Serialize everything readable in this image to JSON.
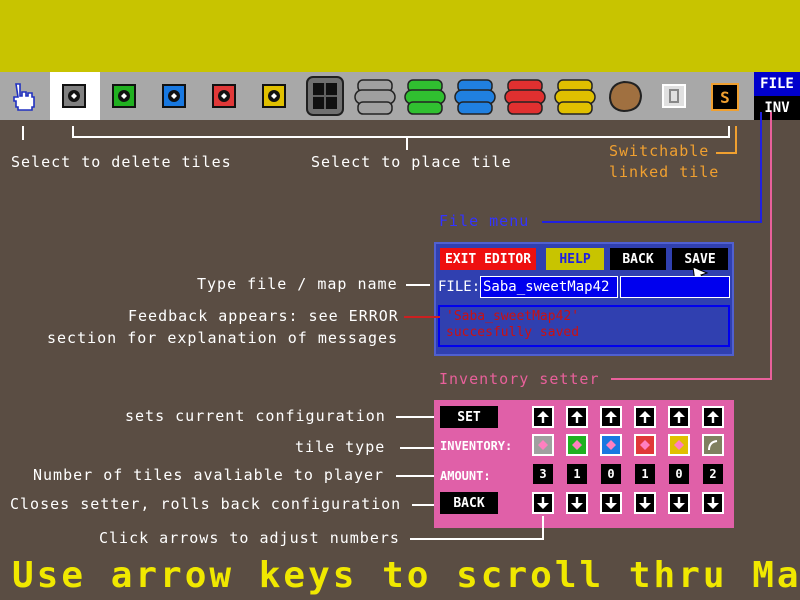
{
  "toolbar": {
    "file_label": "FILE",
    "inv_label": "INV",
    "tile_colors": [
      "#808080",
      "#20b020",
      "#1878e0",
      "#e03838",
      "#e0c000"
    ],
    "tank_colors": [
      "#a0a0a0",
      "#30c030",
      "#2080e0",
      "#e03030",
      "#e0c000"
    ],
    "switch_tile_label": "S"
  },
  "callouts": {
    "delete": "Select to delete tiles",
    "place": "Select to place tile",
    "switchable": "Switchable",
    "linked": "linked tile",
    "file_menu": "File menu",
    "type_name": "Type file / map name",
    "feedback_1": "Feedback appears: see ERROR",
    "feedback_2": "section for explanation of messages",
    "inventory_setter": "Inventory setter",
    "sets_config": "sets current configuration",
    "tile_type": "tile type",
    "num_tiles": "Number of tiles avaliable to player",
    "closes": "Closes setter, rolls back configuration",
    "click_arrows": "Click arrows to adjust numbers"
  },
  "file_menu": {
    "exit": "EXIT EDITOR",
    "help": "HELP",
    "back": "BACK",
    "save": "SAVE",
    "file_label": "FILE:",
    "file_value": "Saba_sweetMap42",
    "feedback_line1": "'Saba_sweetMap42'",
    "feedback_line2": "succesfully saved"
  },
  "inventory": {
    "set": "SET",
    "inventory_label": "INVENTORY:",
    "amount_label": "AMOUNT:",
    "back": "BACK",
    "tile_colors": [
      "#a0a0a0",
      "#20b020",
      "#1878e0",
      "#e03838",
      "#e0c000",
      "#808060"
    ],
    "amounts": [
      "3",
      "1",
      "0",
      "1",
      "0",
      "2"
    ]
  },
  "footer": "Use arrow keys to scroll thru Map"
}
